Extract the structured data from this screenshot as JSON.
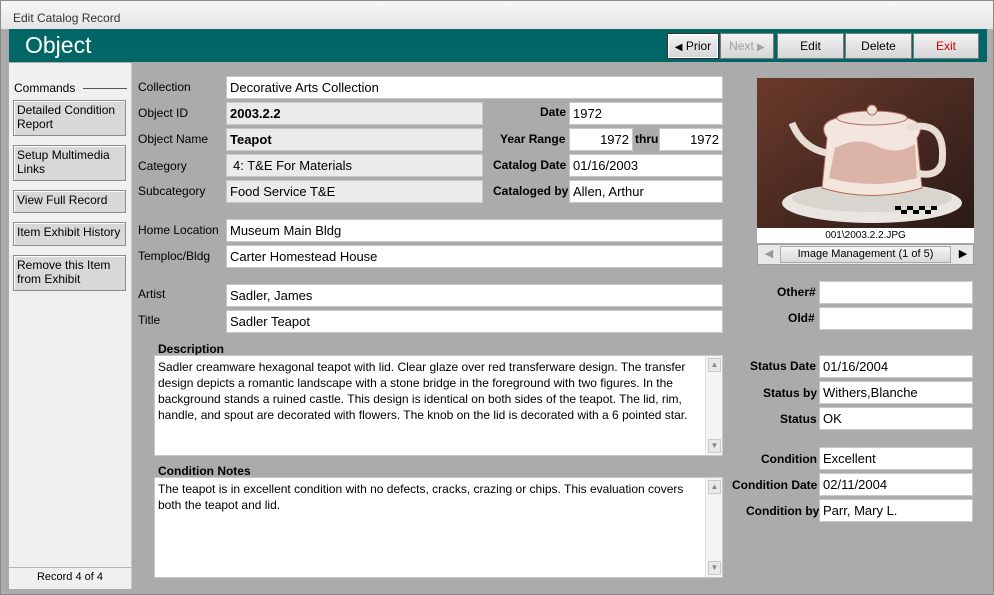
{
  "window": {
    "title": "Edit Catalog Record"
  },
  "header": {
    "title": "Object",
    "buttons": {
      "prior": "Prior",
      "next": "Next",
      "edit": "Edit",
      "delete": "Delete",
      "exit": "Exit"
    },
    "colors": {
      "bar": "#006766"
    }
  },
  "sidebar": {
    "title": "Commands",
    "buttons": [
      "Detailed Condition Report",
      "Setup Multimedia Links",
      "View Full Record",
      "Item Exhibit History",
      "Remove this Item from Exhibit"
    ],
    "record_nav": "Record 4 of 4"
  },
  "labels": {
    "collection": "Collection",
    "object_id": "Object ID",
    "object_name": "Object Name",
    "category": "Category",
    "subcategory": "Subcategory",
    "date": "Date",
    "year_range": "Year Range",
    "thru": "thru",
    "catalog_date": "Catalog Date",
    "cataloged_by": "Cataloged by",
    "home_location": "Home Location",
    "temploc": "Temploc/Bldg",
    "artist": "Artist",
    "title": "Title",
    "other_num": "Other#",
    "old_num": "Old#",
    "description": "Description",
    "condition_notes": "Condition Notes",
    "status_date": "Status Date",
    "status_by": "Status by",
    "status": "Status",
    "condition": "Condition",
    "condition_date": "Condition Date",
    "condition_by": "Condition by"
  },
  "fields": {
    "collection": "Decorative Arts Collection",
    "object_id": "2003.2.2",
    "object_name": "Teapot",
    "category": "4: T&E For Materials",
    "subcategory": "Food Service T&E",
    "date": "1972",
    "year_from": "1972",
    "year_to": "1972",
    "catalog_date": "01/16/2003",
    "cataloged_by": "Allen, Arthur",
    "home_location": "Museum Main Bldg",
    "temploc": "Carter Homestead House",
    "artist": "Sadler, James",
    "title": "Sadler Teapot",
    "other_num": "",
    "old_num": "",
    "description": "Sadler creamware hexagonal teapot with lid. Clear glaze over red  transferware design. The transfer design depicts a romantic  landscape with a stone bridge in the foreground with two figures. In the background stands a ruined castle. This design is  identical on both sides of the teapot.  The lid, rim, handle, and spout are decorated with flowers.  The knob on the lid is decorated with a 6 pointed star.",
    "condition_notes": "The teapot is in excellent condition with no defects, cracks, crazing or chips.  This evaluation covers both the teapot and lid.",
    "status_date": "01/16/2004",
    "status_by": "Withers,Blanche",
    "status": "OK",
    "condition": "Excellent",
    "condition_date": "02/11/2004",
    "condition_by": "Parr, Mary L."
  },
  "image": {
    "filename": "001\\2003.2.2.JPG",
    "management": "Image Management (1 of 5)"
  }
}
